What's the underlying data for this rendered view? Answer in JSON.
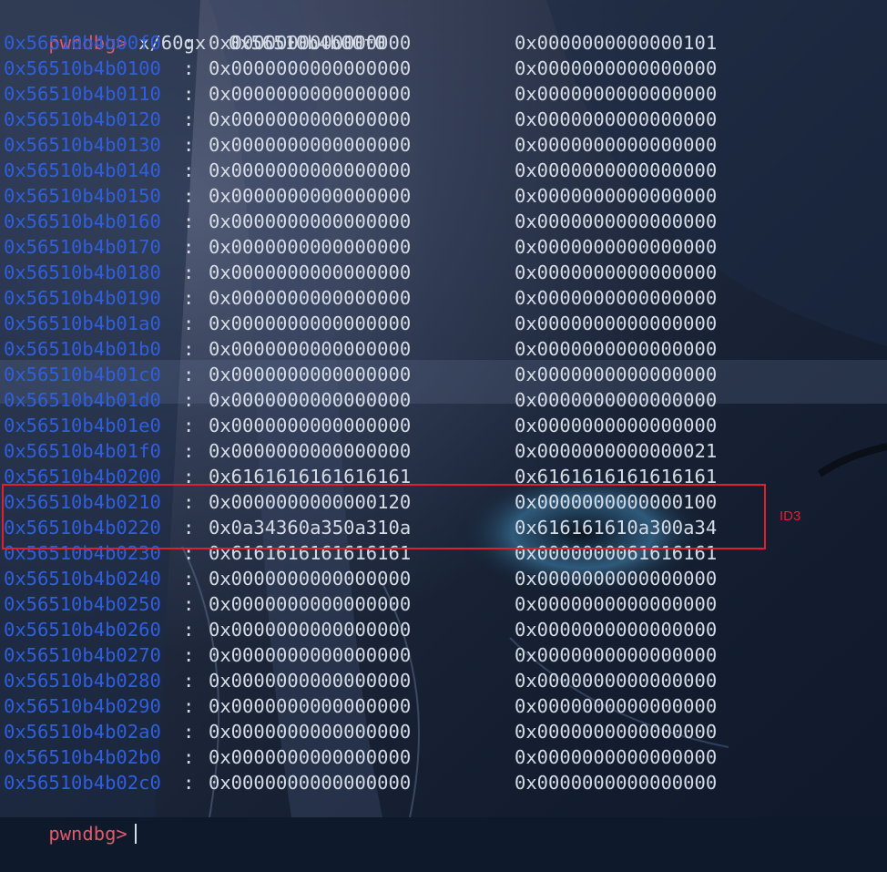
{
  "colors": {
    "prompt": "#e05a6a",
    "address": "#2f5fe0",
    "value": "#d6dce6",
    "highlight": "#e0202e"
  },
  "prompt": "pwndbg>",
  "command": "x/60gx  0x56510b4b00f0",
  "rows": [
    {
      "addr": "0x56510b4b00f0",
      "v1": "0x0000000000000000",
      "v2": "0x0000000000000101"
    },
    {
      "addr": "0x56510b4b0100",
      "v1": "0x0000000000000000",
      "v2": "0x0000000000000000"
    },
    {
      "addr": "0x56510b4b0110",
      "v1": "0x0000000000000000",
      "v2": "0x0000000000000000"
    },
    {
      "addr": "0x56510b4b0120",
      "v1": "0x0000000000000000",
      "v2": "0x0000000000000000"
    },
    {
      "addr": "0x56510b4b0130",
      "v1": "0x0000000000000000",
      "v2": "0x0000000000000000"
    },
    {
      "addr": "0x56510b4b0140",
      "v1": "0x0000000000000000",
      "v2": "0x0000000000000000"
    },
    {
      "addr": "0x56510b4b0150",
      "v1": "0x0000000000000000",
      "v2": "0x0000000000000000"
    },
    {
      "addr": "0x56510b4b0160",
      "v1": "0x0000000000000000",
      "v2": "0x0000000000000000"
    },
    {
      "addr": "0x56510b4b0170",
      "v1": "0x0000000000000000",
      "v2": "0x0000000000000000"
    },
    {
      "addr": "0x56510b4b0180",
      "v1": "0x0000000000000000",
      "v2": "0x0000000000000000"
    },
    {
      "addr": "0x56510b4b0190",
      "v1": "0x0000000000000000",
      "v2": "0x0000000000000000"
    },
    {
      "addr": "0x56510b4b01a0",
      "v1": "0x0000000000000000",
      "v2": "0x0000000000000000"
    },
    {
      "addr": "0x56510b4b01b0",
      "v1": "0x0000000000000000",
      "v2": "0x0000000000000000"
    },
    {
      "addr": "0x56510b4b01c0",
      "v1": "0x0000000000000000",
      "v2": "0x0000000000000000"
    },
    {
      "addr": "0x56510b4b01d0",
      "v1": "0x0000000000000000",
      "v2": "0x0000000000000000"
    },
    {
      "addr": "0x56510b4b01e0",
      "v1": "0x0000000000000000",
      "v2": "0x0000000000000000"
    },
    {
      "addr": "0x56510b4b01f0",
      "v1": "0x0000000000000000",
      "v2": "0x0000000000000021"
    },
    {
      "addr": "0x56510b4b0200",
      "v1": "0x6161616161616161",
      "v2": "0x6161616161616161"
    },
    {
      "addr": "0x56510b4b0210",
      "v1": "0x0000000000000120",
      "v2": "0x0000000000000100"
    },
    {
      "addr": "0x56510b4b0220",
      "v1": "0x0a34360a350a310a",
      "v2": "0x616161610a300a34"
    },
    {
      "addr": "0x56510b4b0230",
      "v1": "0x6161616161616161",
      "v2": "0x0000000061616161"
    },
    {
      "addr": "0x56510b4b0240",
      "v1": "0x0000000000000000",
      "v2": "0x0000000000000000"
    },
    {
      "addr": "0x56510b4b0250",
      "v1": "0x0000000000000000",
      "v2": "0x0000000000000000"
    },
    {
      "addr": "0x56510b4b0260",
      "v1": "0x0000000000000000",
      "v2": "0x0000000000000000"
    },
    {
      "addr": "0x56510b4b0270",
      "v1": "0x0000000000000000",
      "v2": "0x0000000000000000"
    },
    {
      "addr": "0x56510b4b0280",
      "v1": "0x0000000000000000",
      "v2": "0x0000000000000000"
    },
    {
      "addr": "0x56510b4b0290",
      "v1": "0x0000000000000000",
      "v2": "0x0000000000000000"
    },
    {
      "addr": "0x56510b4b02a0",
      "v1": "0x0000000000000000",
      "v2": "0x0000000000000000"
    },
    {
      "addr": "0x56510b4b02b0",
      "v1": "0x0000000000000000",
      "v2": "0x0000000000000000"
    },
    {
      "addr": "0x56510b4b02c0",
      "v1": "0x0000000000000000",
      "v2": "0x0000000000000000"
    }
  ],
  "highlight_label": "ID3"
}
